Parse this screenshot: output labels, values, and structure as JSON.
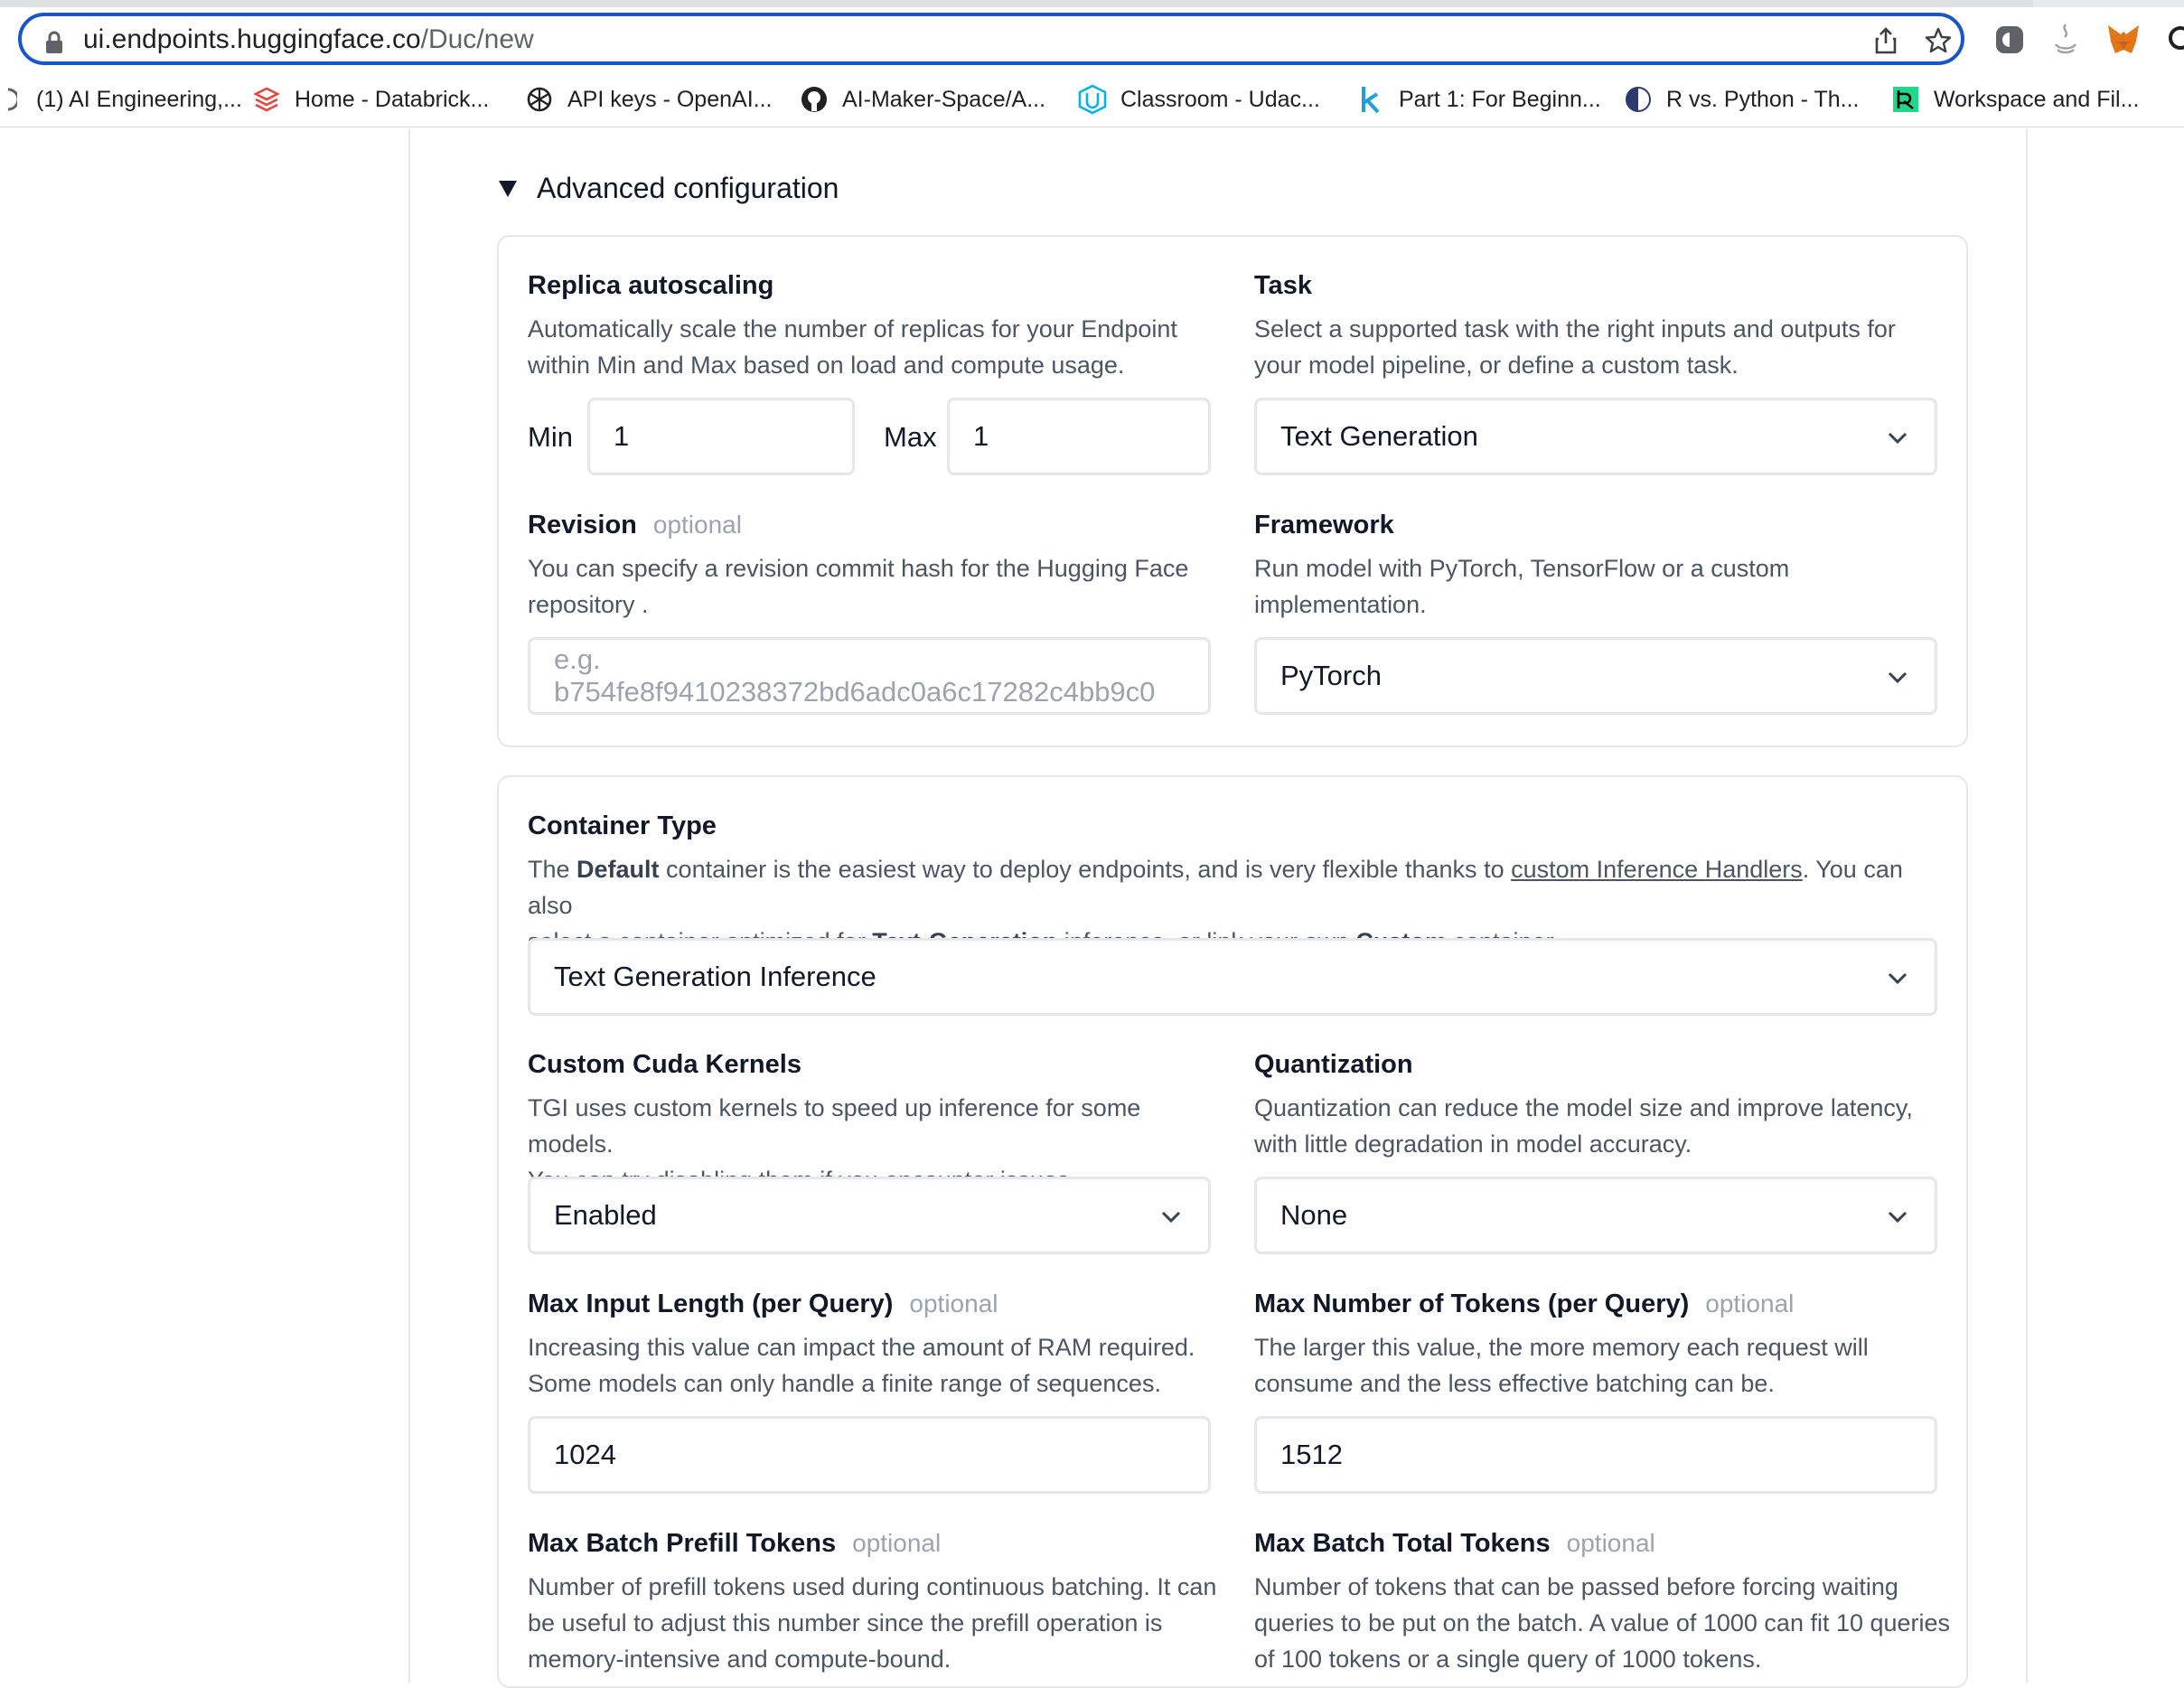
{
  "browser": {
    "url_host": "ui.endpoints.huggingface.co",
    "url_path": "/Duc/new",
    "bookmarks": [
      {
        "label": "(1) AI Engineering,...",
        "icon": "page-icon"
      },
      {
        "label": "Home - Databrick...",
        "icon": "databricks-icon"
      },
      {
        "label": "API keys - OpenAI...",
        "icon": "openai-icon"
      },
      {
        "label": "AI-Maker-Space/A...",
        "icon": "github-icon"
      },
      {
        "label": "Classroom - Udac...",
        "icon": "udacity-icon"
      },
      {
        "label": "Part 1: For Beginn...",
        "icon": "k-icon"
      },
      {
        "label": "R vs. Python - Th...",
        "icon": "r-vs-python-icon"
      },
      {
        "label": "Workspace and Fil...",
        "icon": "workspace-icon"
      }
    ],
    "extension_icons": [
      "extension-icon",
      "java-icon",
      "metamask-icon",
      "search-icon"
    ]
  },
  "advanced": {
    "toggle_label": "Advanced configuration",
    "replica": {
      "label": "Replica autoscaling",
      "desc_line1": "Automatically scale the number of replicas for your Endpoint",
      "desc_line2": "within Min and Max based on load and compute usage.",
      "min_label": "Min",
      "min_value": "1",
      "max_label": "Max",
      "max_value": "1"
    },
    "task": {
      "label": "Task",
      "desc_line1": "Select a supported task with the right inputs and outputs for",
      "desc_line2": "your model pipeline, or define a custom task.",
      "value": "Text Generation"
    },
    "revision": {
      "label": "Revision",
      "optional": "optional",
      "desc_line1": "You can specify a revision commit hash for the Hugging Face",
      "desc_line2": "repository .",
      "placeholder": "e.g. b754fe8f9410238372bd6adc0a6c17282c4bb9c0"
    },
    "framework": {
      "label": "Framework",
      "desc_line1": "Run model with PyTorch, TensorFlow or a custom",
      "desc_line2": "implementation.",
      "value": "PyTorch"
    }
  },
  "container": {
    "label": "Container Type",
    "desc": {
      "p1": "The ",
      "b1": "Default",
      "p2": " container is the easiest way to deploy endpoints, and is very flexible thanks to ",
      "link": "custom Inference Handlers",
      "p3": ". You can also",
      "p4": "select a container optimized for ",
      "b2": "Text-Generation",
      "p5": " inference, or link your own ",
      "b3": "Custom",
      "p6": " container."
    },
    "value": "Text Generation Inference",
    "cuda": {
      "label": "Custom Cuda Kernels",
      "desc_line1": "TGI uses custom kernels to speed up inference for some models.",
      "desc_line2": "You can try disabling them if you encounter issues.",
      "value": "Enabled"
    },
    "quantization": {
      "label": "Quantization",
      "desc_line1": "Quantization can reduce the model size and improve latency,",
      "desc_line2": "with little degradation in model accuracy.",
      "value": "None"
    },
    "max_input": {
      "label": "Max Input Length (per Query)",
      "optional": "optional",
      "desc_line1": "Increasing this value can impact the amount of RAM required.",
      "desc_line2": "Some models can only handle a finite range of sequences.",
      "value": "1024"
    },
    "max_tokens": {
      "label": "Max Number of Tokens (per Query)",
      "optional": "optional",
      "desc_line1": "The larger this value, the more memory each request will",
      "desc_line2": "consume and the less effective batching can be.",
      "value": "1512"
    },
    "prefill": {
      "label": "Max Batch Prefill Tokens",
      "optional": "optional",
      "desc_line1": "Number of prefill tokens used during continuous batching. It can",
      "desc_line2": "be useful to adjust this number since the prefill operation is",
      "desc_line3": "memory-intensive and compute-bound."
    },
    "total": {
      "label": "Max Batch Total Tokens",
      "optional": "optional",
      "desc_line1": "Number of tokens that can be passed before forcing waiting",
      "desc_line2": "queries to be put on the batch. A value of 1000 can fit 10 queries",
      "desc_line3": "of 100 tokens or a single query of 1000 tokens."
    }
  }
}
